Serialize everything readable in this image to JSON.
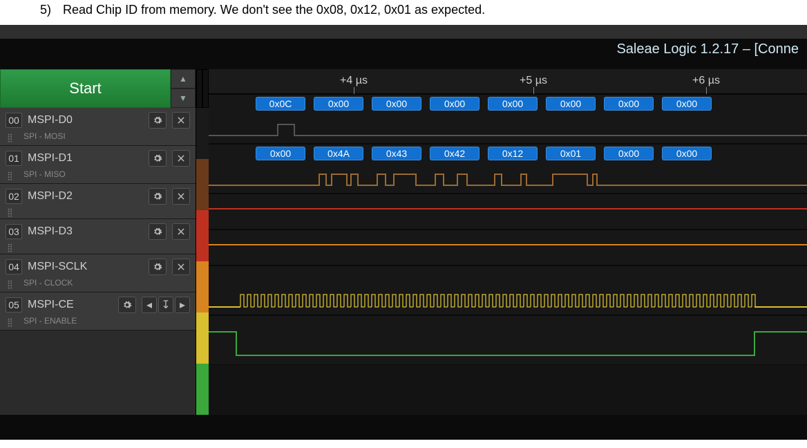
{
  "caption": {
    "num": "5)",
    "text": "Read Chip ID from memory. We don't see the 0x08, 0x12, 0x01 as expected."
  },
  "app_title": "Saleae Logic 1.2.17 – [Conne",
  "start_label": "Start",
  "ruler": {
    "labels": [
      "+4 µs",
      "+5 µs",
      "+6 µs"
    ]
  },
  "channels": [
    {
      "index": "00",
      "name": "MSPI-D0",
      "analyzer": "SPI - MOSI",
      "color": "#1a1a1a"
    },
    {
      "index": "01",
      "name": "MSPI-D1",
      "analyzer": "SPI - MISO",
      "color": "#6b3a1a"
    },
    {
      "index": "02",
      "name": "MSPI-D2",
      "analyzer": "",
      "color": "#c03020"
    },
    {
      "index": "03",
      "name": "MSPI-D3",
      "analyzer": "",
      "color": "#d88420"
    },
    {
      "index": "04",
      "name": "MSPI-SCLK",
      "analyzer": "SPI - CLOCK",
      "color": "#d8c030"
    },
    {
      "index": "05",
      "name": "MSPI-CE",
      "analyzer": "SPI - ENABLE",
      "color": "#3aa83a"
    }
  ],
  "decoded": {
    "mosi": [
      "0x0C",
      "0x00",
      "0x00",
      "0x00",
      "0x00",
      "0x00",
      "0x00",
      "0x00"
    ],
    "miso": [
      "0x00",
      "0x4A",
      "0x43",
      "0x42",
      "0x12",
      "0x01",
      "0x00",
      "0x00"
    ]
  },
  "icons": {
    "gear": "gear",
    "close": "close",
    "up": "▲",
    "down": "▼",
    "trig_prev": "◂",
    "trig_edge": "↧",
    "trig_next": "▸"
  }
}
